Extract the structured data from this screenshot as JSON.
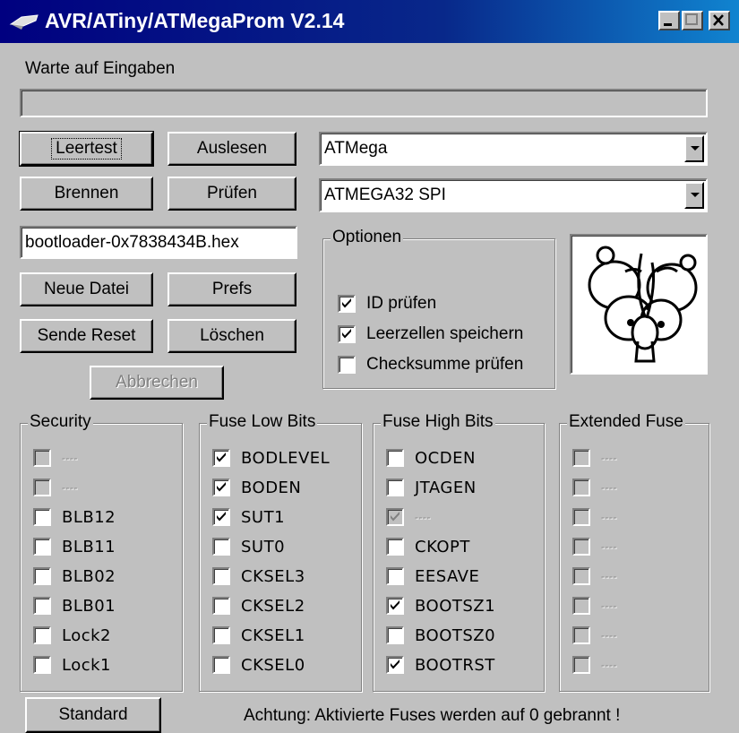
{
  "window": {
    "title": "AVR/ATiny/ATMegaProm V2.14",
    "buttons": [
      "minimize",
      "maximize",
      "close"
    ]
  },
  "status": {
    "text": "Warte auf Eingaben",
    "progress": 0
  },
  "buttons": {
    "leertest": "Leertest",
    "auslesen": "Auslesen",
    "brennen": "Brennen",
    "pruefen": "Prüfen",
    "neue_datei": "Neue Datei",
    "prefs": "Prefs",
    "sende_reset": "Sende Reset",
    "loeschen": "Löschen",
    "abbrechen": "Abbrechen",
    "standard": "Standard"
  },
  "family_select": {
    "value": "ATMega"
  },
  "device_select": {
    "value": "ATMEGA32 SPI"
  },
  "file_field": {
    "value": "bootloader-0x7838434B.hex"
  },
  "optionen": {
    "label": "Optionen",
    "items": [
      {
        "label": "ID prüfen",
        "checked": true
      },
      {
        "label": "Leerzellen speichern",
        "checked": true
      },
      {
        "label": "Checksumme prüfen",
        "checked": false
      }
    ]
  },
  "security": {
    "label": "Security",
    "items": [
      {
        "label": "----",
        "checked": false,
        "enabled": false
      },
      {
        "label": "----",
        "checked": false,
        "enabled": false
      },
      {
        "label": "BLB12",
        "checked": false,
        "enabled": true
      },
      {
        "label": "BLB11",
        "checked": false,
        "enabled": true
      },
      {
        "label": "BLB02",
        "checked": false,
        "enabled": true
      },
      {
        "label": "BLB01",
        "checked": false,
        "enabled": true
      },
      {
        "label": "Lock2",
        "checked": false,
        "enabled": true
      },
      {
        "label": "Lock1",
        "checked": false,
        "enabled": true
      }
    ]
  },
  "fuse_low": {
    "label": "Fuse Low Bits",
    "items": [
      {
        "label": "BODLEVEL",
        "checked": true,
        "enabled": true
      },
      {
        "label": "BODEN",
        "checked": true,
        "enabled": true
      },
      {
        "label": "SUT1",
        "checked": true,
        "enabled": true
      },
      {
        "label": "SUT0",
        "checked": false,
        "enabled": true
      },
      {
        "label": "CKSEL3",
        "checked": false,
        "enabled": true
      },
      {
        "label": "CKSEL2",
        "checked": false,
        "enabled": true
      },
      {
        "label": "CKSEL1",
        "checked": false,
        "enabled": true
      },
      {
        "label": "CKSEL0",
        "checked": false,
        "enabled": true
      }
    ]
  },
  "fuse_high": {
    "label": "Fuse High Bits",
    "items": [
      {
        "label": "OCDEN",
        "checked": false,
        "enabled": true
      },
      {
        "label": "JTAGEN",
        "checked": false,
        "enabled": true
      },
      {
        "label": "----",
        "checked": true,
        "enabled": false
      },
      {
        "label": "CKOPT",
        "checked": false,
        "enabled": true
      },
      {
        "label": "EESAVE",
        "checked": false,
        "enabled": true
      },
      {
        "label": "BOOTSZ1",
        "checked": true,
        "enabled": true
      },
      {
        "label": "BOOTSZ0",
        "checked": false,
        "enabled": true
      },
      {
        "label": "BOOTRST",
        "checked": true,
        "enabled": true
      }
    ]
  },
  "extended_fuse": {
    "label": "Extended Fuse",
    "items": [
      {
        "label": "----",
        "checked": false,
        "enabled": false
      },
      {
        "label": "----",
        "checked": false,
        "enabled": false
      },
      {
        "label": "----",
        "checked": false,
        "enabled": false
      },
      {
        "label": "----",
        "checked": false,
        "enabled": false
      },
      {
        "label": "----",
        "checked": false,
        "enabled": false
      },
      {
        "label": "----",
        "checked": false,
        "enabled": false
      },
      {
        "label": "----",
        "checked": false,
        "enabled": false
      },
      {
        "label": "----",
        "checked": false,
        "enabled": false
      }
    ]
  },
  "footer": {
    "warning": "Achtung: Aktivierte Fuses werden auf 0 gebrannt !"
  },
  "logo": {
    "icon": "cartoon-bug-icon"
  }
}
